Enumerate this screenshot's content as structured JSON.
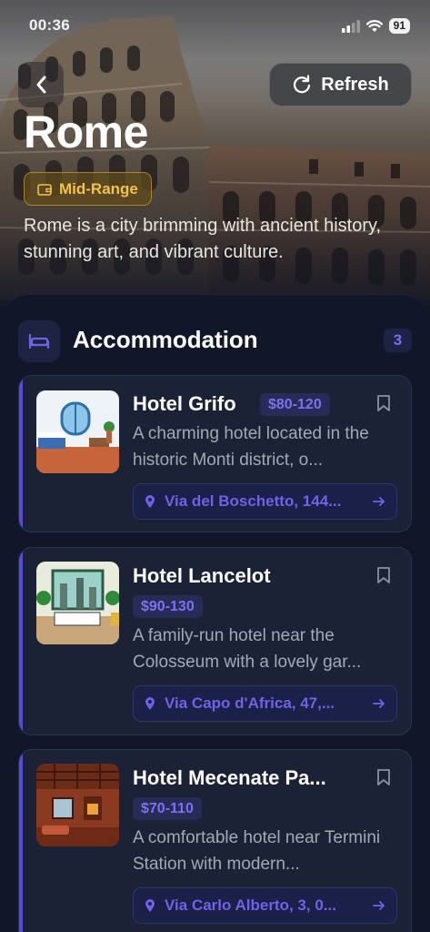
{
  "status_bar": {
    "time": "00:36",
    "battery": "91"
  },
  "header": {
    "refresh_label": "Refresh",
    "city": "Rome",
    "budget": "Mid-Range",
    "description": "Rome is a city brimming with ancient history, stunning art, and vibrant culture."
  },
  "section": {
    "title": "Accommodation",
    "count": "3",
    "icon": "bed-icon"
  },
  "hotels": [
    {
      "name": "Hotel Grifo",
      "price": "$80-120",
      "description": "A charming hotel located in the historic Monti district, o...",
      "address": "Via del Boschetto, 144..."
    },
    {
      "name": "Hotel Lancelot",
      "price": "$90-130",
      "description": "A family-run hotel near the Colosseum with a lovely gar...",
      "address": "Via Capo d'Africa, 47,..."
    },
    {
      "name": "Hotel Mecenate Pa...",
      "price": "$70-110",
      "description": "A comfortable hotel near Termini Station with modern...",
      "address": "Via Carlo Alberto, 3, 0..."
    }
  ],
  "colors": {
    "accent": "#5b4ad6",
    "price_text": "#7e70f2",
    "budget_gold": "#f2c14e",
    "card_bg": "#1c2236"
  }
}
